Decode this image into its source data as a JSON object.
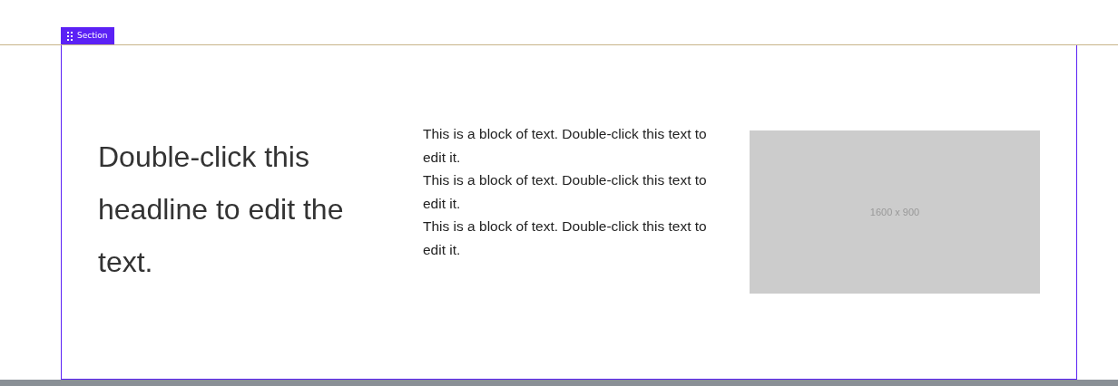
{
  "section_label": "Section",
  "headline": "Double-click this headline to edit the text.",
  "paragraphs": [
    "This is a block of text. Double-click this text to edit it.",
    "This is a block of text. Double-click this text to edit it.",
    "This is a block of text. Double-click this text to edit it."
  ],
  "image_placeholder": "1600 x 900"
}
